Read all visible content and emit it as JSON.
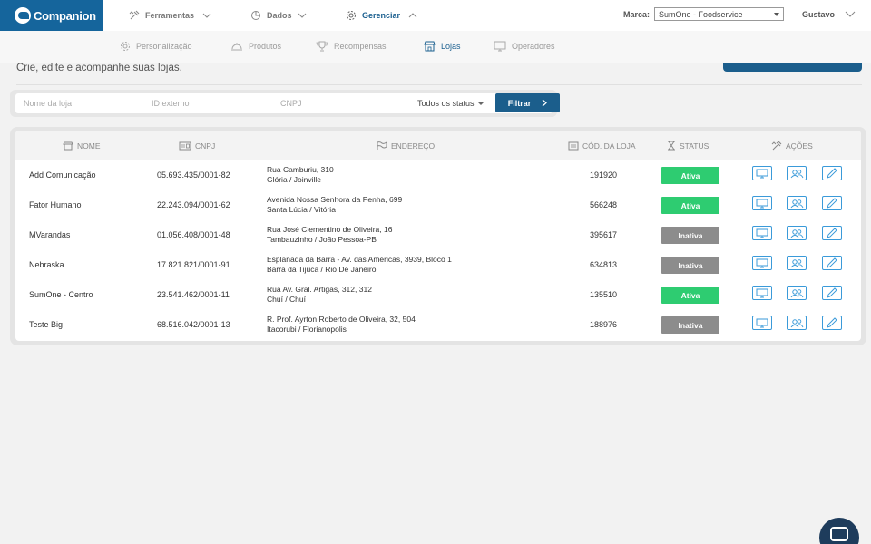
{
  "app": {
    "logo_text": "Companion"
  },
  "top_nav": {
    "items": [
      {
        "label": "Ferramentas",
        "icon": "tools-icon"
      },
      {
        "label": "Dados",
        "icon": "pie-chart-icon"
      },
      {
        "label": "Gerenciar",
        "icon": "gear-icon"
      }
    ],
    "marca_label": "Marca:",
    "marca_value": "SumOne - Foodservice",
    "user": "Gustavo"
  },
  "sub_nav": {
    "items": [
      {
        "label": "Personalização",
        "icon": "gear-icon"
      },
      {
        "label": "Produtos",
        "icon": "dome-icon"
      },
      {
        "label": "Recompensas",
        "icon": "trophy-icon"
      },
      {
        "label": "Lojas",
        "icon": "store-icon"
      },
      {
        "label": "Operadores",
        "icon": "monitor-icon"
      }
    ]
  },
  "page": {
    "description": "Crie, edite e acompanhe suas lojas."
  },
  "filters": {
    "name_placeholder": "Nome da loja",
    "external_id_placeholder": "ID externo",
    "cnpj_placeholder": "CNPJ",
    "status_label": "Todos os status",
    "filter_button": "Filtrar"
  },
  "table": {
    "headers": [
      "NOME",
      "CNPJ",
      "ENDEREÇO",
      "CÓD. DA LOJA",
      "STATUS",
      "AÇÕES"
    ],
    "rows": [
      {
        "name": "Add Comunicação",
        "cnpj": "05.693.435/0001-82",
        "addr1": "Rua Camburiu, 310",
        "addr2": "Glória / Joinville",
        "code": "191920",
        "status": "Ativa"
      },
      {
        "name": "Fator Humano",
        "cnpj": "22.243.094/0001-62",
        "addr1": "Avenida Nossa Senhora da Penha, 699",
        "addr2": "Santa Lúcia / Vitória",
        "code": "566248",
        "status": "Ativa"
      },
      {
        "name": "MVarandas",
        "cnpj": "01.056.408/0001-48",
        "addr1": "Rua José Clementino de Oliveira, 16",
        "addr2": "Tambauzinho / João Pessoa-PB",
        "code": "395617",
        "status": "Inativa"
      },
      {
        "name": "Nebraska",
        "cnpj": "17.821.821/0001-91",
        "addr1": "Esplanada da Barra - Av. das Américas, 3939, Bloco 1",
        "addr2": "Barra da Tijuca / Rio De Janeiro",
        "code": "634813",
        "status": "Inativa"
      },
      {
        "name": "SumOne - Centro",
        "cnpj": "23.541.462/0001-11",
        "addr1": "Rua Av. Gral. Artigas, 312, 312",
        "addr2": "Chuí / Chuí",
        "code": "135510",
        "status": "Ativa"
      },
      {
        "name": "Teste Big",
        "cnpj": "68.516.042/0001-13",
        "addr1": "R. Prof. Ayrton Roberto de Oliveira, 32, 504",
        "addr2": "Itacorubi / Florianopolis",
        "code": "188976",
        "status": "Inativa"
      }
    ]
  },
  "colors": {
    "brand": "#15659c",
    "active_status": "#2ecc71",
    "inactive_status": "#8c8c8c",
    "action_icon": "#3a9ad9"
  }
}
